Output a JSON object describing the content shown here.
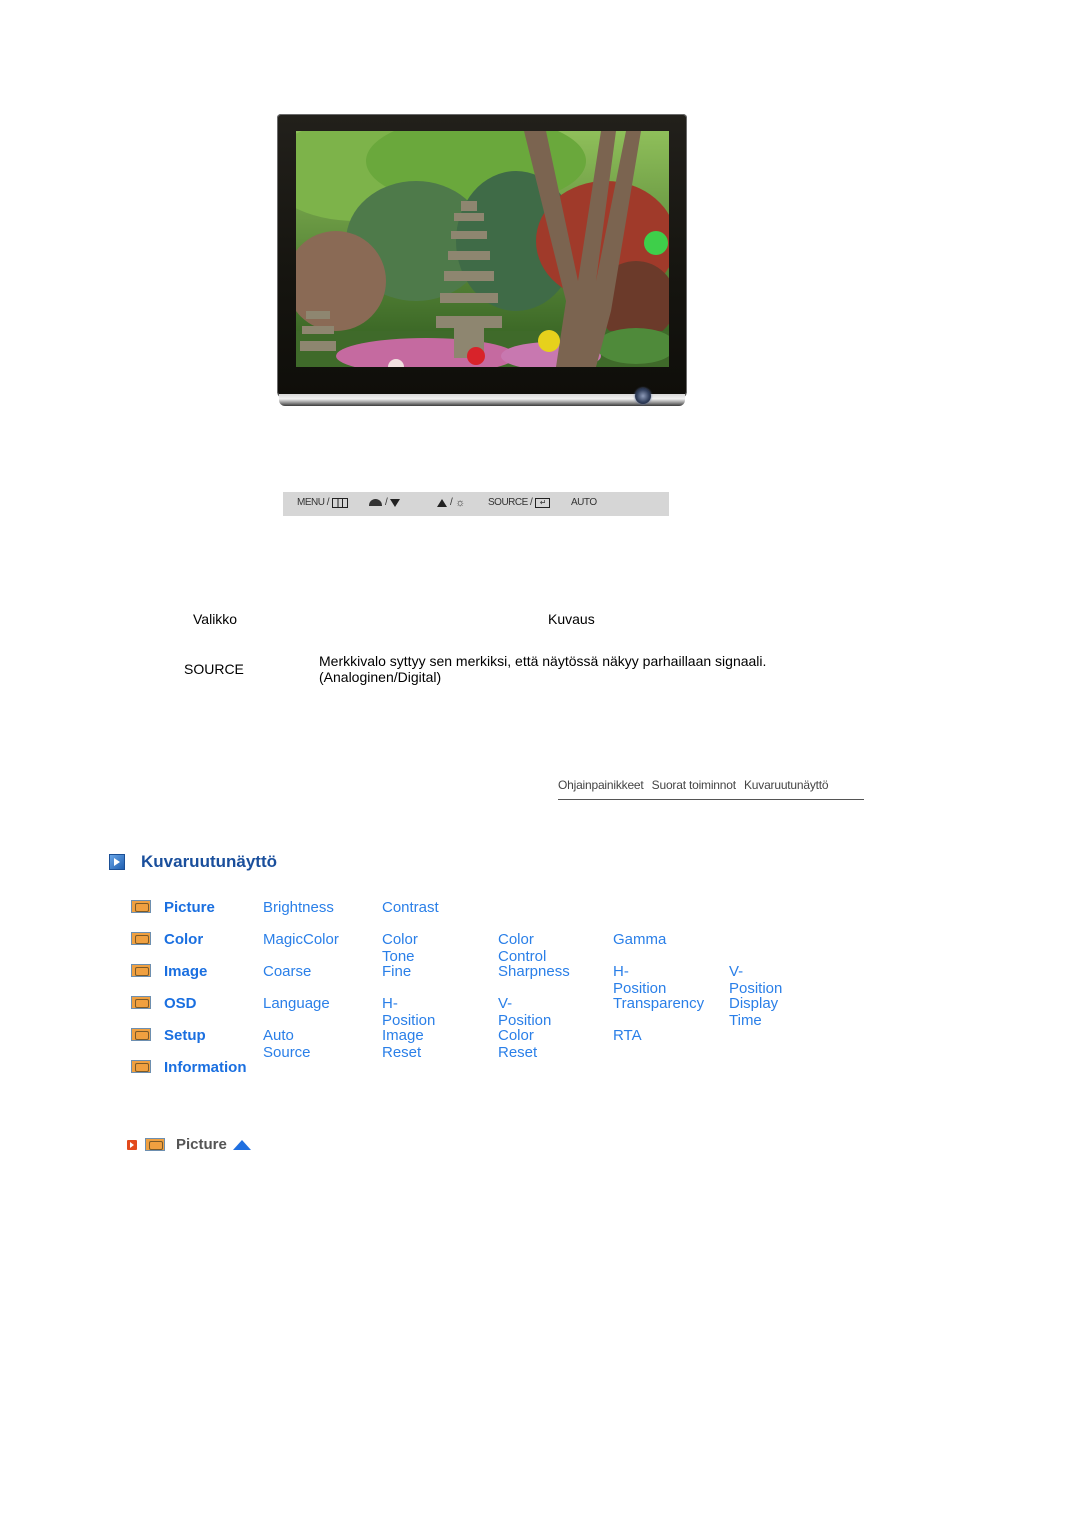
{
  "monitor": {
    "image_alt": "Monitor displaying a garden with stone pagoda and lanterns",
    "power_icon": "power-button-icon"
  },
  "button_strip": {
    "menu_label": "MENU /",
    "menu_icon": "menu-grid-icon",
    "magic_icon": "magicbright-icon",
    "down_sep": "/",
    "up_sep": "/",
    "brightness_icon": "brightness-sun-icon",
    "source_label": "SOURCE /",
    "enter_icon": "enter-icon",
    "auto_label": "AUTO"
  },
  "table": {
    "header_menu": "Valikko",
    "header_description": "Kuvaus",
    "rows": [
      {
        "menu": "SOURCE",
        "description_line1": "Merkkivalo syttyy sen merkiksi, että näytössä näkyy parhaillaan signaali.",
        "description_line2": "(Analoginen/Digital)"
      }
    ]
  },
  "breadcrumbs": [
    "Ohjainpainikkeet",
    "Suorat toiminnot",
    "Kuvaruutunäyttö"
  ],
  "section": {
    "title": "Kuvaruutunäyttö"
  },
  "menu": [
    {
      "category": "Picture",
      "icon": "picture-icon",
      "items": [
        "Brightness",
        "Contrast"
      ]
    },
    {
      "category": "Color",
      "icon": "color-icon",
      "items": [
        "MagicColor",
        "Color Tone",
        "Color Control",
        "Gamma"
      ]
    },
    {
      "category": "Image",
      "icon": "image-icon",
      "items": [
        "Coarse",
        "Fine",
        "Sharpness",
        "H-Position",
        "V-Position"
      ]
    },
    {
      "category": "OSD",
      "icon": "osd-icon",
      "items": [
        "Language",
        "H-Position",
        "V-Position",
        "Transparency",
        "Display Time"
      ]
    },
    {
      "category": "Setup",
      "icon": "setup-icon",
      "items": [
        "Auto Source",
        "Image Reset",
        "Color Reset",
        "RTA"
      ]
    },
    {
      "category": "Information",
      "icon": "information-icon",
      "items": []
    }
  ],
  "sub_nav": {
    "label": "Picture",
    "up_icon": "scroll-up-icon"
  }
}
